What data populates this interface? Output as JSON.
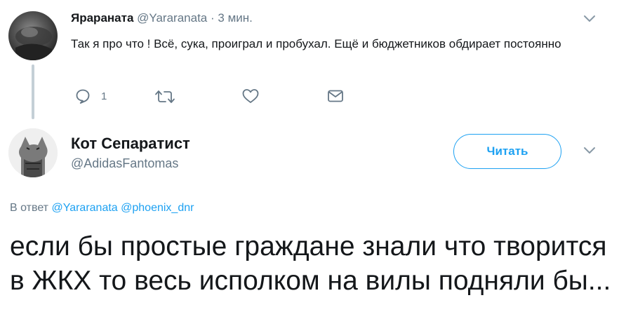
{
  "parent_tweet": {
    "name": "Ярараната",
    "handle": "@Yararanata",
    "separator": "·",
    "time": "3 мин.",
    "text": "Так я про что ! Всё, сука, проиграл и пробухал. Ещё и бюджетников обдирает постоянно",
    "reply_count": "1"
  },
  "main_tweet": {
    "name": "Кот Сепаратист",
    "handle": "@AdidasFantomas",
    "follow_label": "Читать",
    "reply_prefix": "В ответ",
    "mentions": [
      "@Yararanata",
      "@phoenix_dnr"
    ],
    "text": "если бы простые граждане знали что творится в ЖКХ то весь исполком на вилы подняли бы..."
  },
  "colors": {
    "accent": "#1da1f2",
    "muted": "#657786",
    "text": "#14171a",
    "thread_line": "#c4cfd6"
  },
  "icons": [
    "reply-icon",
    "retweet-icon",
    "like-icon",
    "message-icon",
    "chevron-down-icon"
  ]
}
